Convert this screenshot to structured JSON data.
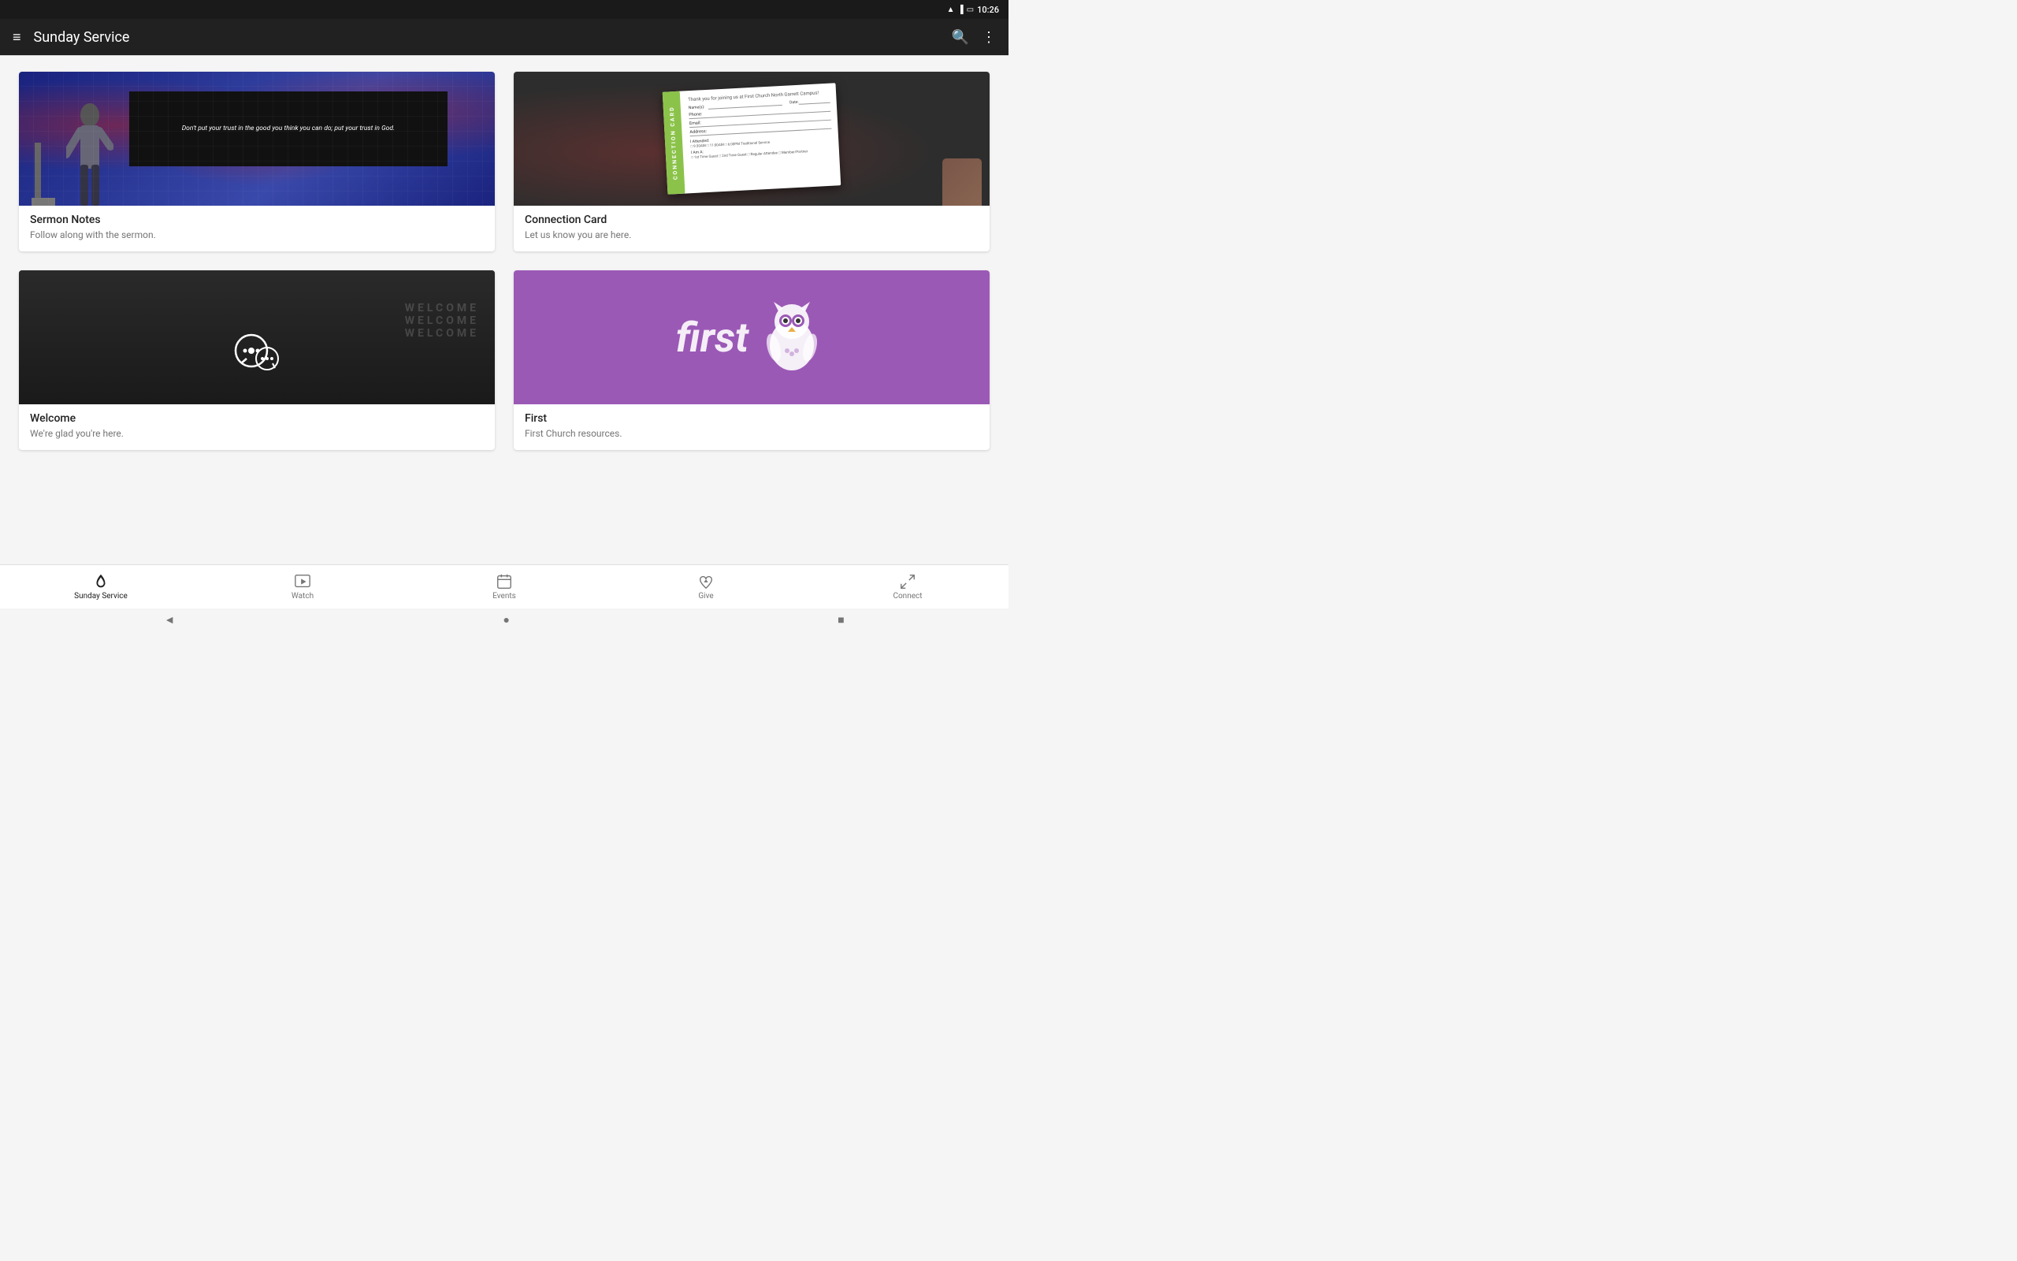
{
  "statusBar": {
    "time": "10:26",
    "wifiIcon": "wifi",
    "signalIcon": "signal",
    "batteryIcon": "battery"
  },
  "appBar": {
    "title": "Sunday Service",
    "menuIcon": "≡",
    "searchIcon": "🔍",
    "moreIcon": "⋮"
  },
  "cards": [
    {
      "id": "sermon-notes",
      "title": "Sermon Notes",
      "subtitle": "Follow along with the sermon.",
      "imageType": "sermon",
      "screenText": "Don't put your trust in the good you think you can do; put your trust in God."
    },
    {
      "id": "connection-card",
      "title": "Connection Card",
      "subtitle": "Let us know you are here.",
      "imageType": "connection",
      "cardLabel": "CONNECTION CARD",
      "fields": [
        "Name(s):",
        "Phone:",
        "Email:",
        "Address:"
      ]
    },
    {
      "id": "welcome",
      "title": "Welcome",
      "subtitle": "We're glad you're here.",
      "imageType": "welcome",
      "welcomeText": [
        "WELCOME",
        "WELCOME",
        "WELCOME"
      ]
    },
    {
      "id": "first-logo",
      "title": "First",
      "subtitle": "First Church resources.",
      "imageType": "first"
    }
  ],
  "bottomNav": [
    {
      "id": "sunday-service",
      "label": "Sunday Service",
      "icon": "flame",
      "active": true
    },
    {
      "id": "watch",
      "label": "Watch",
      "icon": "play",
      "active": false
    },
    {
      "id": "events",
      "label": "Events",
      "icon": "calendar",
      "active": false
    },
    {
      "id": "give",
      "label": "Give",
      "icon": "heart",
      "active": false
    },
    {
      "id": "connect",
      "label": "Connect",
      "icon": "expand",
      "active": false
    }
  ],
  "androidNav": {
    "backIcon": "◄",
    "homeIcon": "●",
    "recentIcon": "■"
  }
}
